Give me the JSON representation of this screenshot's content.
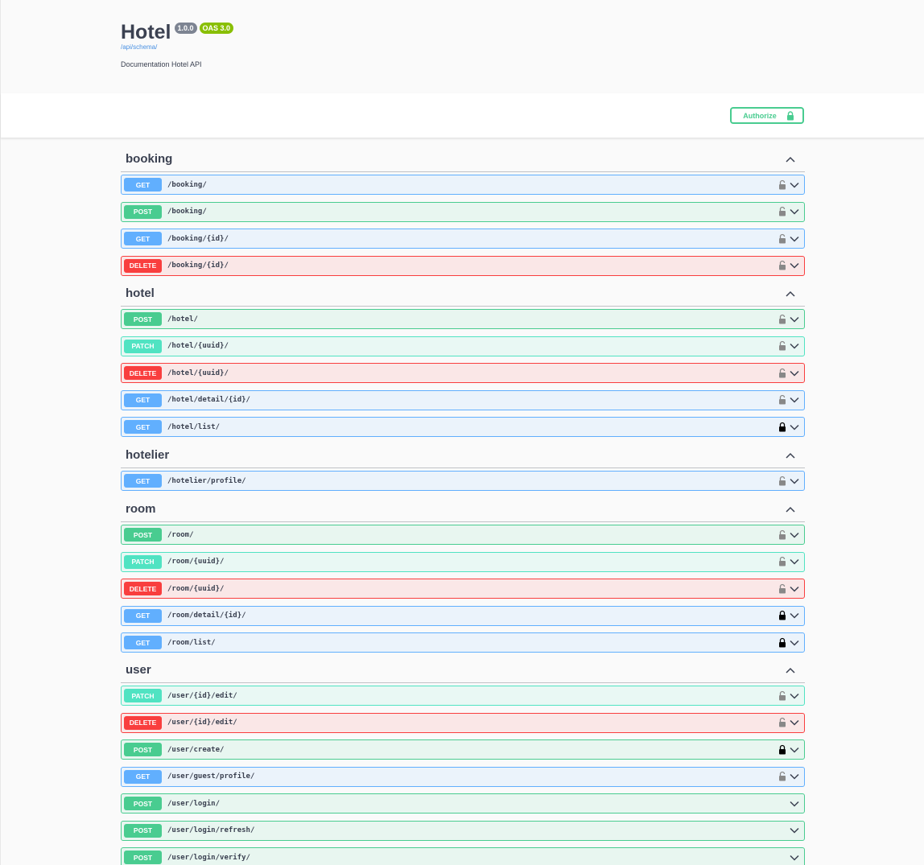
{
  "info": {
    "title": "Hotel",
    "version": "1.0.0",
    "oas": "OAS 3.0",
    "schema_link": "/api/schema/",
    "description": "Documentation Hotel API"
  },
  "authorize_label": "Authorize",
  "tags": [
    {
      "name": "booking",
      "ops": [
        {
          "method": "GET",
          "path": "/booking/",
          "lock": "open"
        },
        {
          "method": "POST",
          "path": "/booking/",
          "lock": "open"
        },
        {
          "method": "GET",
          "path": "/booking/{id}/",
          "lock": "open"
        },
        {
          "method": "DELETE",
          "path": "/booking/{id}/",
          "lock": "open"
        }
      ]
    },
    {
      "name": "hotel",
      "ops": [
        {
          "method": "POST",
          "path": "/hotel/",
          "lock": "open"
        },
        {
          "method": "PATCH",
          "path": "/hotel/{uuid}/",
          "lock": "open"
        },
        {
          "method": "DELETE",
          "path": "/hotel/{uuid}/",
          "lock": "open"
        },
        {
          "method": "GET",
          "path": "/hotel/detail/{id}/",
          "lock": "open"
        },
        {
          "method": "GET",
          "path": "/hotel/list/",
          "lock": "closed"
        }
      ]
    },
    {
      "name": "hotelier",
      "ops": [
        {
          "method": "GET",
          "path": "/hotelier/profile/",
          "lock": "open"
        }
      ]
    },
    {
      "name": "room",
      "ops": [
        {
          "method": "POST",
          "path": "/room/",
          "lock": "open"
        },
        {
          "method": "PATCH",
          "path": "/room/{uuid}/",
          "lock": "open"
        },
        {
          "method": "DELETE",
          "path": "/room/{uuid}/",
          "lock": "open"
        },
        {
          "method": "GET",
          "path": "/room/detail/{id}/",
          "lock": "closed"
        },
        {
          "method": "GET",
          "path": "/room/list/",
          "lock": "closed"
        }
      ]
    },
    {
      "name": "user",
      "ops": [
        {
          "method": "PATCH",
          "path": "/user/{id}/edit/",
          "lock": "open"
        },
        {
          "method": "DELETE",
          "path": "/user/{id}/edit/",
          "lock": "open"
        },
        {
          "method": "POST",
          "path": "/user/create/",
          "lock": "closed"
        },
        {
          "method": "GET",
          "path": "/user/guest/profile/",
          "lock": "open"
        },
        {
          "method": "POST",
          "path": "/user/login/",
          "lock": "none"
        },
        {
          "method": "POST",
          "path": "/user/login/refresh/",
          "lock": "none"
        },
        {
          "method": "POST",
          "path": "/user/login/verify/",
          "lock": "none"
        }
      ]
    }
  ],
  "colors": {
    "get": "#61affe",
    "post": "#49cc90",
    "delete": "#f93e3e",
    "patch": "#50e3c2",
    "authorize": "#49cc90"
  }
}
